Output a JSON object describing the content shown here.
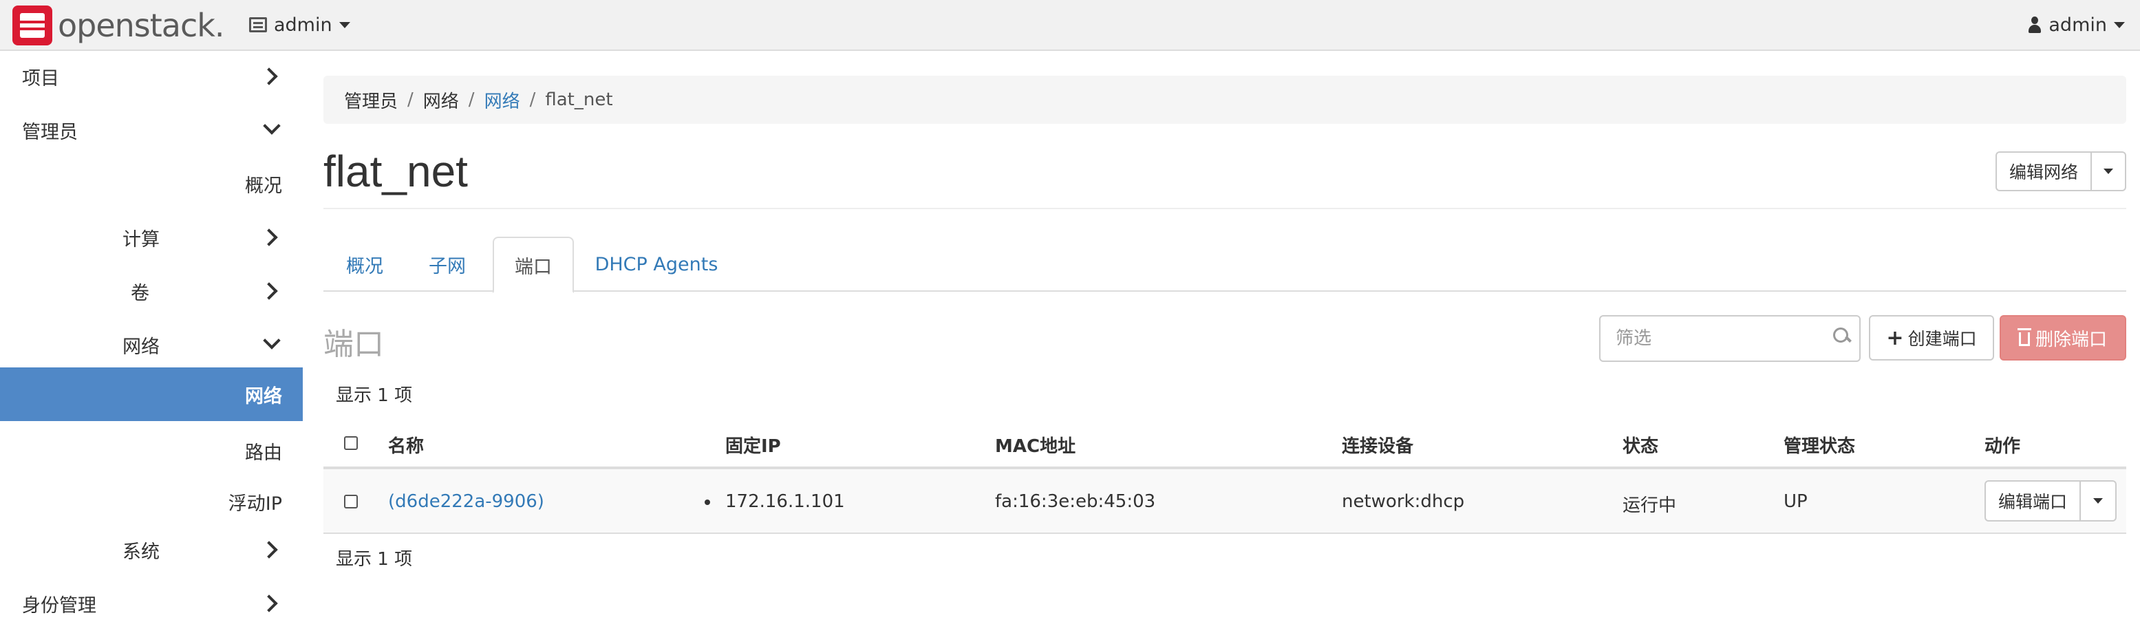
{
  "topbar": {
    "logo_text": "openstack.",
    "project_label": "admin",
    "user_label": "admin"
  },
  "sidebar": {
    "items": [
      {
        "label": "项目"
      },
      {
        "label": "管理员"
      },
      {
        "label": "概况"
      },
      {
        "label": "计算"
      },
      {
        "label": "卷"
      },
      {
        "label": "网络"
      },
      {
        "label": "网络"
      },
      {
        "label": "路由"
      },
      {
        "label": "浮动IP"
      },
      {
        "label": "系统"
      },
      {
        "label": "身份管理"
      }
    ]
  },
  "breadcrumb": {
    "items": [
      "管理员",
      "网络",
      "网络",
      "flat_net"
    ],
    "separator": "/"
  },
  "page": {
    "title": "flat_net",
    "edit_button": "编辑网络"
  },
  "tabs": [
    {
      "label": "概况"
    },
    {
      "label": "子网"
    },
    {
      "label": "端口"
    },
    {
      "label": "DHCP Agents"
    }
  ],
  "ports": {
    "section_title": "端口",
    "search_placeholder": "筛选",
    "create_button": "创建端口",
    "delete_button": "删除端口",
    "count_text": "显示 1 项",
    "columns": [
      "名称",
      "固定IP",
      "MAC地址",
      "连接设备",
      "状态",
      "管理状态",
      "动作"
    ],
    "rows": [
      {
        "name": "(d6de222a-9906)",
        "fixed_ip": "172.16.1.101",
        "mac": "fa:16:3e:eb:45:03",
        "device": "network:dhcp",
        "status": "运行中",
        "admin_state": "UP",
        "action": "编辑端口"
      }
    ]
  },
  "colors": {
    "accent": "#337ab7",
    "active_nav": "#5088c7",
    "danger": "#d9534f",
    "logo_red": "#da1a32"
  }
}
